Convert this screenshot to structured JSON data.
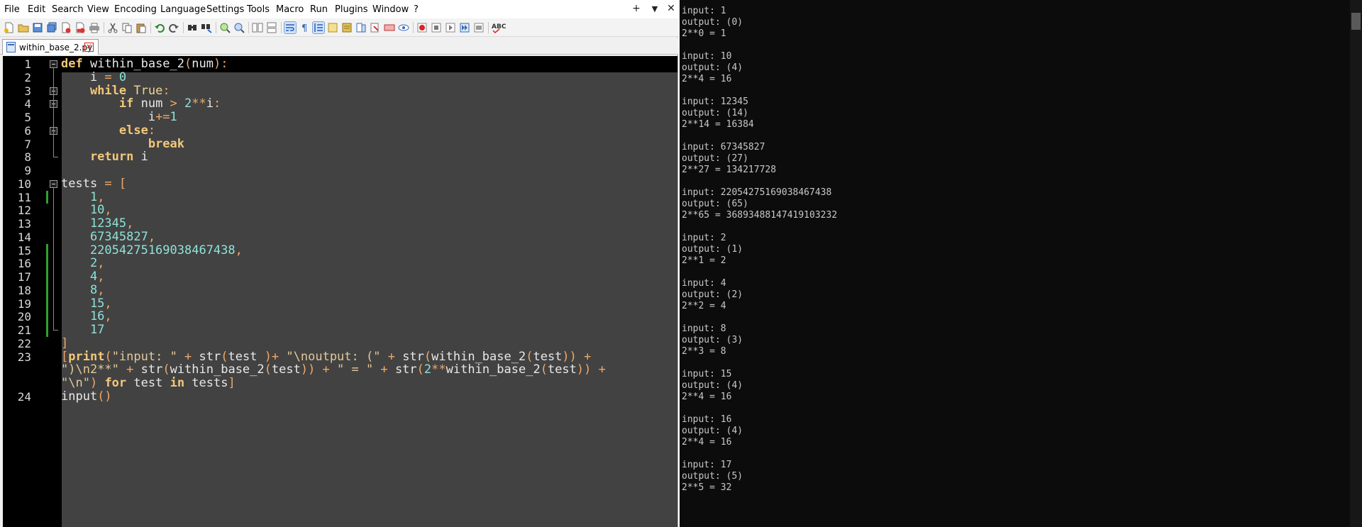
{
  "menu": [
    "File",
    "Edit",
    "Search",
    "View",
    "Encoding",
    "Language",
    "Settings",
    "Tools",
    "Macro",
    "Run",
    "Plugins",
    "Window",
    "?"
  ],
  "window_controls": {
    "add": "+",
    "dropdown": "▼",
    "close": "✕"
  },
  "tab": {
    "title": "within_base_2.py",
    "close": "✕"
  },
  "toolbar_icons": [
    "new-file-icon",
    "open-file-icon",
    "save-icon",
    "save-all-icon",
    "close-icon",
    "close-all-icon",
    "print-icon",
    "cut-icon",
    "copy-icon",
    "paste-icon",
    "undo-icon",
    "redo-icon",
    "find-icon",
    "replace-icon",
    "zoom-in-icon",
    "zoom-out-icon",
    "sync-vertical-icon",
    "sync-horizontal-icon",
    "word-wrap-icon",
    "show-all-chars-icon",
    "indent-guide-icon",
    "user-lang-icon",
    "doc-map-icon",
    "function-list-icon",
    "folder-workspace-icon",
    "monitoring-icon",
    "record-macro-icon",
    "stop-macro-icon",
    "play-macro-icon",
    "run-macro-multiple-icon",
    "save-macro-icon",
    "spell-check-icon"
  ],
  "line_numbers": [
    "1",
    "2",
    "3",
    "4",
    "5",
    "6",
    "7",
    "8",
    "9",
    "10",
    "11",
    "12",
    "13",
    "14",
    "15",
    "16",
    "17",
    "18",
    "19",
    "20",
    "21",
    "22",
    "23",
    "",
    "",
    "24"
  ],
  "code_lines": [
    [
      {
        "t": "def",
        "c": "k"
      },
      {
        "t": " within_base_2",
        "c": "f"
      },
      {
        "t": "(",
        "c": "o"
      },
      {
        "t": "num",
        "c": "f"
      },
      {
        "t": "):",
        "c": "o"
      }
    ],
    [
      {
        "t": "    i ",
        "c": "f"
      },
      {
        "t": "=",
        "c": "o"
      },
      {
        "t": " ",
        "c": "f"
      },
      {
        "t": "0",
        "c": "n"
      }
    ],
    [
      {
        "t": "    while",
        "c": "k"
      },
      {
        "t": " True",
        "c": "b"
      },
      {
        "t": ":",
        "c": "o"
      }
    ],
    [
      {
        "t": "        if",
        "c": "k"
      },
      {
        "t": " num ",
        "c": "f"
      },
      {
        "t": ">",
        "c": "o"
      },
      {
        "t": " ",
        "c": "f"
      },
      {
        "t": "2",
        "c": "n"
      },
      {
        "t": "**",
        "c": "o"
      },
      {
        "t": "i",
        "c": "f"
      },
      {
        "t": ":",
        "c": "o"
      }
    ],
    [
      {
        "t": "            i",
        "c": "f"
      },
      {
        "t": "+=",
        "c": "o"
      },
      {
        "t": "1",
        "c": "n"
      }
    ],
    [
      {
        "t": "        else",
        "c": "k"
      },
      {
        "t": ":",
        "c": "o"
      }
    ],
    [
      {
        "t": "            break",
        "c": "k"
      }
    ],
    [
      {
        "t": "    return",
        "c": "k"
      },
      {
        "t": " i",
        "c": "f"
      }
    ],
    [],
    [
      {
        "t": "tests ",
        "c": "f"
      },
      {
        "t": "=",
        "c": "o"
      },
      {
        "t": " [",
        "c": "o"
      }
    ],
    [
      {
        "t": "    1",
        "c": "n"
      },
      {
        "t": ",",
        "c": "o"
      }
    ],
    [
      {
        "t": "    10",
        "c": "n"
      },
      {
        "t": ",",
        "c": "o"
      }
    ],
    [
      {
        "t": "    12345",
        "c": "n"
      },
      {
        "t": ",",
        "c": "o"
      }
    ],
    [
      {
        "t": "    67345827",
        "c": "n"
      },
      {
        "t": ",",
        "c": "o"
      }
    ],
    [
      {
        "t": "    22054275169038467438",
        "c": "n"
      },
      {
        "t": ",",
        "c": "o"
      }
    ],
    [
      {
        "t": "    2",
        "c": "n"
      },
      {
        "t": ",",
        "c": "o"
      }
    ],
    [
      {
        "t": "    4",
        "c": "n"
      },
      {
        "t": ",",
        "c": "o"
      }
    ],
    [
      {
        "t": "    8",
        "c": "n"
      },
      {
        "t": ",",
        "c": "o"
      }
    ],
    [
      {
        "t": "    15",
        "c": "n"
      },
      {
        "t": ",",
        "c": "o"
      }
    ],
    [
      {
        "t": "    16",
        "c": "n"
      },
      {
        "t": ",",
        "c": "o"
      }
    ],
    [
      {
        "t": "    17",
        "c": "n"
      }
    ],
    [
      {
        "t": "]",
        "c": "o"
      }
    ],
    [
      {
        "t": "[",
        "c": "o"
      },
      {
        "t": "print",
        "c": "k"
      },
      {
        "t": "(",
        "c": "o"
      },
      {
        "t": "\"input: \"",
        "c": "s"
      },
      {
        "t": " + ",
        "c": "o"
      },
      {
        "t": "str",
        "c": "f"
      },
      {
        "t": "(",
        "c": "o"
      },
      {
        "t": "test ",
        "c": "f"
      },
      {
        "t": ")+",
        "c": "o"
      },
      {
        "t": " \"\\noutput: (\"",
        "c": "s"
      },
      {
        "t": " + ",
        "c": "o"
      },
      {
        "t": "str",
        "c": "f"
      },
      {
        "t": "(",
        "c": "o"
      },
      {
        "t": "within_base_2",
        "c": "f"
      },
      {
        "t": "(",
        "c": "o"
      },
      {
        "t": "test",
        "c": "f"
      },
      {
        "t": ")) +",
        "c": "o"
      }
    ],
    [
      {
        "t": "\")\\n2**\"",
        "c": "s"
      },
      {
        "t": " + ",
        "c": "o"
      },
      {
        "t": "str",
        "c": "f"
      },
      {
        "t": "(",
        "c": "o"
      },
      {
        "t": "within_base_2",
        "c": "f"
      },
      {
        "t": "(",
        "c": "o"
      },
      {
        "t": "test",
        "c": "f"
      },
      {
        "t": ")) + ",
        "c": "o"
      },
      {
        "t": "\" = \"",
        "c": "s"
      },
      {
        "t": " + ",
        "c": "o"
      },
      {
        "t": "str",
        "c": "f"
      },
      {
        "t": "(",
        "c": "o"
      },
      {
        "t": "2",
        "c": "n"
      },
      {
        "t": "**",
        "c": "o"
      },
      {
        "t": "within_base_2",
        "c": "f"
      },
      {
        "t": "(",
        "c": "o"
      },
      {
        "t": "test",
        "c": "f"
      },
      {
        "t": ")) +",
        "c": "o"
      }
    ],
    [
      {
        "t": "\"\\n\"",
        "c": "s"
      },
      {
        "t": ") ",
        "c": "o"
      },
      {
        "t": "for",
        "c": "k"
      },
      {
        "t": " test ",
        "c": "f"
      },
      {
        "t": "in",
        "c": "k"
      },
      {
        "t": " tests",
        "c": "f"
      },
      {
        "t": "]",
        "c": "o"
      }
    ],
    [
      {
        "t": "input",
        "c": "f"
      },
      {
        "t": "()",
        "c": "o"
      }
    ]
  ],
  "console_lines": [
    "input: 1",
    "output: (0)",
    "2**0 = 1",
    "",
    "input: 10",
    "output: (4)",
    "2**4 = 16",
    "",
    "input: 12345",
    "output: (14)",
    "2**14 = 16384",
    "",
    "input: 67345827",
    "output: (27)",
    "2**27 = 134217728",
    "",
    "input: 22054275169038467438",
    "output: (65)",
    "2**65 = 36893488147419103232",
    "",
    "input: 2",
    "output: (1)",
    "2**1 = 2",
    "",
    "input: 4",
    "output: (2)",
    "2**2 = 4",
    "",
    "input: 8",
    "output: (3)",
    "2**3 = 8",
    "",
    "input: 15",
    "output: (4)",
    "2**4 = 16",
    "",
    "input: 16",
    "output: (4)",
    "2**4 = 16",
    "",
    "input: 17",
    "output: (5)",
    "2**5 = 32"
  ]
}
